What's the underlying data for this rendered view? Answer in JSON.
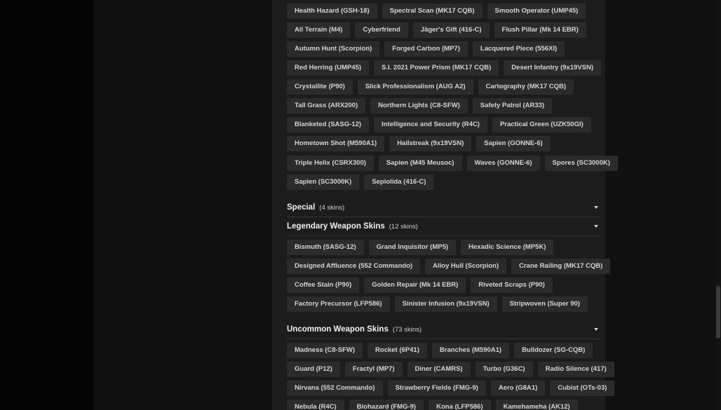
{
  "sections": [
    {
      "id": "rare-top",
      "rows": [
        [
          "Health Hazard (GSH-18)",
          "Spectral Scan (MK17 CQB)",
          "Smooth Operator (UMP45)"
        ],
        [
          "All Terrain (M4)",
          "Cyberfriend",
          "Jäger's Gift (416-C)",
          "Flush Pillar (Mk 14 EBR)"
        ],
        [
          "Autumn Hunt (Scorpion)",
          "Forged Carbon (MP7)",
          "Lacquered Piece (556XI)"
        ],
        [
          "Red Herring (UMP45)",
          "S.I. 2021 Power Prism (MK17 CQB)",
          "Desert Infantry (9x19VSN)"
        ],
        [
          "Crystallite (P90)",
          "Slick Professionalism (AUG A2)",
          "Cartography (MK17 CQB)"
        ],
        [
          "Tall Grass (ARX200)",
          "Northern Lights (C8-SFW)",
          "Safety Patrol (AR33)"
        ],
        [
          "Blanketed (SASG-12)",
          "Intelligence and Security (R4C)",
          "Practical Green (UZK50GI)"
        ],
        [
          "Hometown Shot (M590A1)",
          "Hailstreak (9x19VSN)",
          "Sapien (GONNE-6)"
        ],
        [
          "Triple Helix (CSRX300)",
          "Sapien (M45 Meusoc)",
          "Waves (GONNE-6)",
          "Spores (SC3000K)"
        ],
        [
          "Sapien (SC3000K)",
          "Sepiolida (416-C)"
        ]
      ]
    },
    {
      "id": "special",
      "title": "Special",
      "count": "(4 skins)",
      "rows": []
    },
    {
      "id": "legendary",
      "title": "Legendary Weapon Skins",
      "count": "(12 skins)",
      "rows": [
        [
          "Bismuth (SASG-12)",
          "Grand Inquisitor (MP5)",
          "Hexadic Science (MP5K)"
        ],
        [
          "Designed Affluence (552 Commando)",
          "Alloy Hull (Scorpion)",
          "Crane Railing (MK17 CQB)"
        ],
        [
          "Coffee Stain (P90)",
          "Golden Repair (Mk 14 EBR)",
          "Riveted Scraps (P90)"
        ],
        [
          "Factory Precursor (LFP586)",
          "Sinister Infusion (9x19VSN)",
          "Stripwoven (Super 90)"
        ]
      ]
    },
    {
      "id": "uncommon",
      "title": "Uncommon Weapon Skins",
      "count": "(73 skins)",
      "rows": [
        [
          "Madness (C8-SFW)",
          "Rocket (6P41)",
          "Branches (M590A1)",
          "Bulldozer (SG-CQB)"
        ],
        [
          "Guard (P12)",
          "Fractyl (MP7)",
          "Diner (CAMRS)",
          "Turbo (G36C)",
          "Radio Silence (417)"
        ],
        [
          "Nirvana (552 Commando)",
          "Strawberry Fields (FMG-9)",
          "Aero (G8A1)",
          "Cubist (OTs-03)"
        ],
        [
          "Nebula (R4C)",
          "Biohazard (FMG-9)",
          "Kona (LFP586)",
          "Kamehameha (AK12)"
        ]
      ]
    }
  ]
}
